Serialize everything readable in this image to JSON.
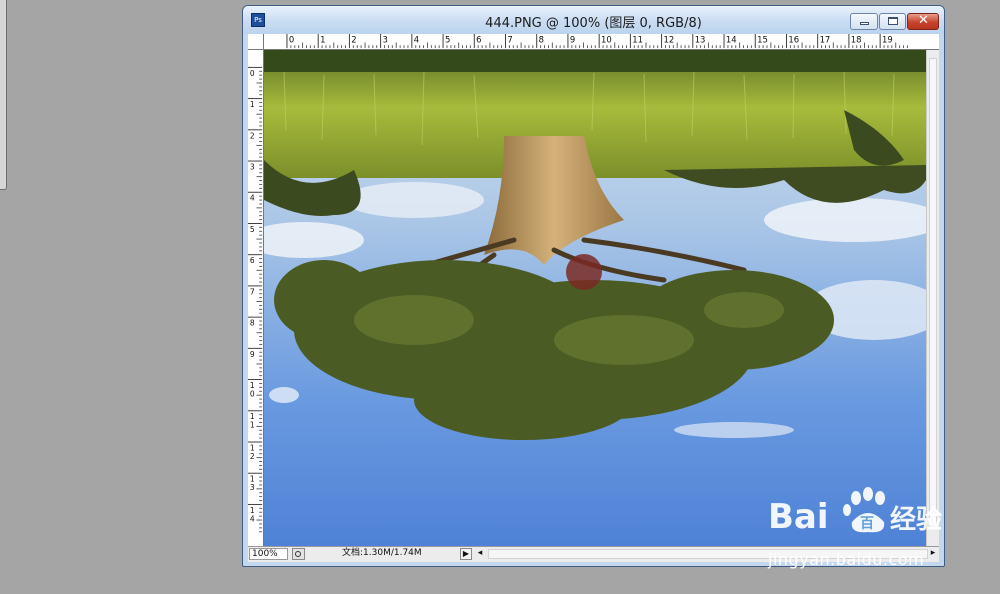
{
  "window": {
    "title": "444.PNG @ 100% (图层 0, RGB/8)",
    "app_icon_label": "Ps",
    "controls": {
      "minimize": "minimize",
      "maximize": "maximize",
      "close": "✕"
    }
  },
  "rulers": {
    "horizontal_labels": [
      "0",
      "1",
      "2",
      "3",
      "4",
      "5",
      "6",
      "7",
      "8",
      "9",
      "10",
      "11",
      "12",
      "13",
      "14",
      "15",
      "16",
      "17",
      "18",
      "19"
    ],
    "vertical_labels": [
      "0",
      "1",
      "2",
      "3",
      "4",
      "5",
      "6",
      "7",
      "8",
      "9",
      "10",
      "11",
      "12",
      "13",
      "14"
    ]
  },
  "statusbar": {
    "zoom": "100%",
    "doc_info": "文档:1.30M/1.74M",
    "menu_arrow": "▶",
    "scroll_left": "◂",
    "scroll_right": "▸"
  },
  "canvas": {
    "image_description_colors": {
      "sky": "#5c8ed9",
      "grass": "#9ab335",
      "trunk": "#c29a5c",
      "foliage": "#4a5a23"
    }
  },
  "watermark": {
    "logo_text": "Bai",
    "logo_text_2": "百",
    "logo_suffix": "经验",
    "url": "jingyan.baidu.com"
  },
  "colors": {
    "desktop": "#a5a5a5",
    "window_frame": "#c3d7ee",
    "close_button": "#c8432d"
  }
}
